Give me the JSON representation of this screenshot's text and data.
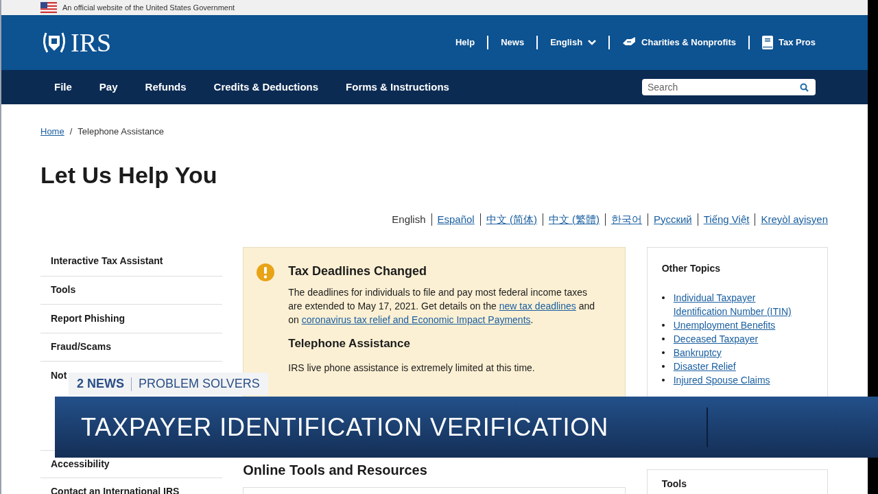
{
  "gov_banner": {
    "text": "An official website of the United States Government"
  },
  "header": {
    "logo": "IRS",
    "links": [
      {
        "label": "Help",
        "kind": "text"
      },
      {
        "label": "News",
        "kind": "text"
      },
      {
        "label": "English",
        "kind": "dropdown"
      },
      {
        "label": "Charities & Nonprofits",
        "kind": "charity"
      },
      {
        "label": "Tax Pros",
        "kind": "book"
      }
    ]
  },
  "nav": {
    "items": [
      "File",
      "Pay",
      "Refunds",
      "Credits & Deductions",
      "Forms & Instructions"
    ],
    "search": {
      "placeholder": "Search"
    }
  },
  "breadcrumb": {
    "separator": "/",
    "items": [
      {
        "label": "Home",
        "link": true
      },
      {
        "label": "Telephone Assistance",
        "link": false
      }
    ]
  },
  "page_title": "Let Us Help You",
  "languages": [
    {
      "label": "English",
      "selected": true
    },
    {
      "label": "Español",
      "selected": false
    },
    {
      "label": "中文 (简体)",
      "selected": false
    },
    {
      "label": "中文 (繁體)",
      "selected": false
    },
    {
      "label": "한국어",
      "selected": false
    },
    {
      "label": "Русский",
      "selected": false
    },
    {
      "label": "Tiếng Việt",
      "selected": false
    },
    {
      "label": "Kreyòl ayisyen",
      "selected": false
    }
  ],
  "sidebar": {
    "items": [
      "Interactive Tax Assistant",
      "Tools",
      "Report Phishing",
      "Fraud/Scams",
      "Not"
    ],
    "items_below_overlay": [
      "Accessibility",
      "Contact an International IRS"
    ]
  },
  "alert": {
    "title": "Tax Deadlines Changed",
    "body": [
      {
        "text": "The deadlines for individuals to file and pay most federal income taxes are extended to May 17, 2021. Get details on the",
        "link": false
      },
      {
        "text": "new tax deadlines",
        "link": true
      },
      {
        "text": "and on",
        "link": false
      },
      {
        "text": "coronavirus tax relief and Economic Impact Payments",
        "link": true
      },
      {
        "text": ".",
        "link": false
      }
    ],
    "subtitle": "Telephone Assistance",
    "sub_body": "IRS live phone assistance is extremely limited at this time."
  },
  "online_tools": {
    "title": "Online Tools and Resources"
  },
  "other_topics": {
    "title": "Other Topics",
    "links": [
      "Individual Taxpayer Identification Number (ITIN)",
      "Unemployment Benefits",
      "Deceased Taxpayer",
      "Bankruptcy",
      "Disaster Relief",
      "Injured Spouse Claims"
    ]
  },
  "tools_box": {
    "title": "Tools"
  },
  "news_overlay": {
    "brand": "2 NEWS",
    "segment": "PROBLEM SOLVERS",
    "headline": "TAXPAYER IDENTIFICATION VERIFICATION"
  }
}
